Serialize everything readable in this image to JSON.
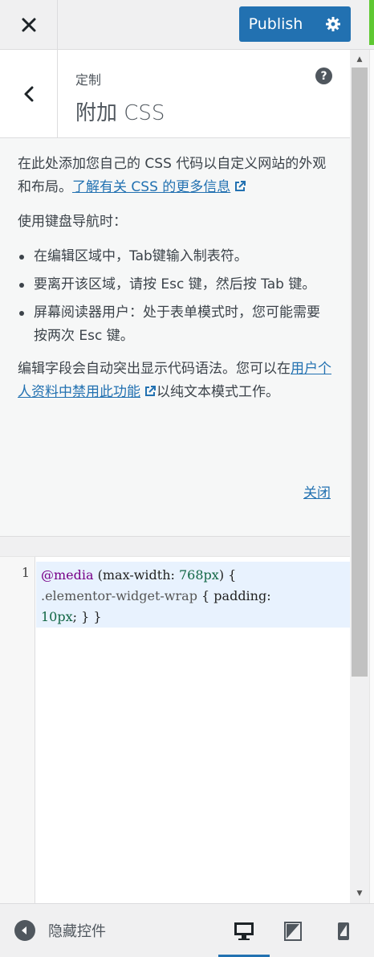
{
  "header": {
    "close_icon": "×",
    "publish_label": "Publish"
  },
  "section": {
    "breadcrumb": "定制",
    "title": "附加 CSS",
    "help_icon": "?"
  },
  "description": {
    "intro": "在此处添加您自己的 CSS 代码以自定义网站的外观和布局。",
    "intro_link": "了解有关 CSS 的更多信息",
    "keyboard_heading": "使用键盘导航时：",
    "bullets": [
      "在编辑区域中，Tab键输入制表符。",
      "要离开该区域，请按 Esc 键，然后按 Tab 键。",
      "屏幕阅读器用户：处于表单模式时，您可能需要按两次 Esc 键。"
    ],
    "syntax_before": "编辑字段会自动突出显示代码语法。您可以在",
    "syntax_link": "用户个人资料中禁用此功能",
    "syntax_after": "以纯文本模式工作。",
    "close_label": "关闭"
  },
  "editor": {
    "line_number": "1",
    "tok_at": "@media",
    "tok_paren_open": " (max-width: ",
    "tok_num1": "768px",
    "tok_paren_close": ") {",
    "tok_class": ".elementor-widget-wrap",
    "tok_brace": " { padding:",
    "tok_num2": "10px",
    "tok_end": "; } }"
  },
  "footer": {
    "hide_controls_label": "隐藏控件",
    "devices": [
      "desktop",
      "tablet",
      "mobile"
    ],
    "active_device": "desktop"
  },
  "colors": {
    "accent": "#2271b1",
    "green_edge": "#5ec832"
  }
}
